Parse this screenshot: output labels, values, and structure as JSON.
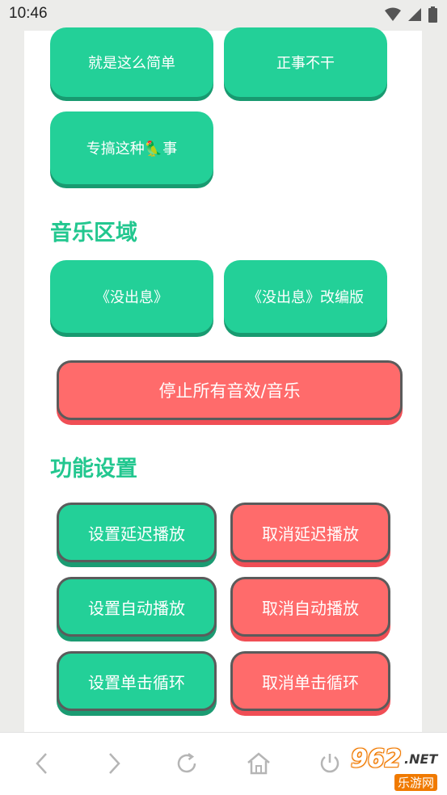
{
  "status": {
    "time": "10:46"
  },
  "top_buttons": [
    {
      "label": "就是这么简单"
    },
    {
      "label": "正事不干"
    },
    {
      "label": "专搞这种🦜事"
    }
  ],
  "music": {
    "title": "音乐区域",
    "buttons": [
      {
        "label": "《没出息》"
      },
      {
        "label": "《没出息》改编版"
      }
    ],
    "stop_label": "停止所有音效/音乐"
  },
  "settings": {
    "title": "功能设置",
    "set_delay": "设置延迟播放",
    "cancel_delay": "取消延迟播放",
    "set_auto": "设置自动播放",
    "cancel_auto": "取消自动播放",
    "set_loop": "设置单击循环",
    "cancel_loop": "取消单击循环"
  },
  "watermark": {
    "number": "962",
    "suffix": ".NET",
    "label": "乐游网"
  },
  "colors": {
    "green": "#23d098",
    "red": "#ff6b6b",
    "title_green": "#22c78f"
  },
  "icons": [
    "wifi-icon",
    "signal-icon",
    "battery-icon",
    "back-icon",
    "forward-icon",
    "refresh-icon",
    "home-icon",
    "power-icon"
  ]
}
